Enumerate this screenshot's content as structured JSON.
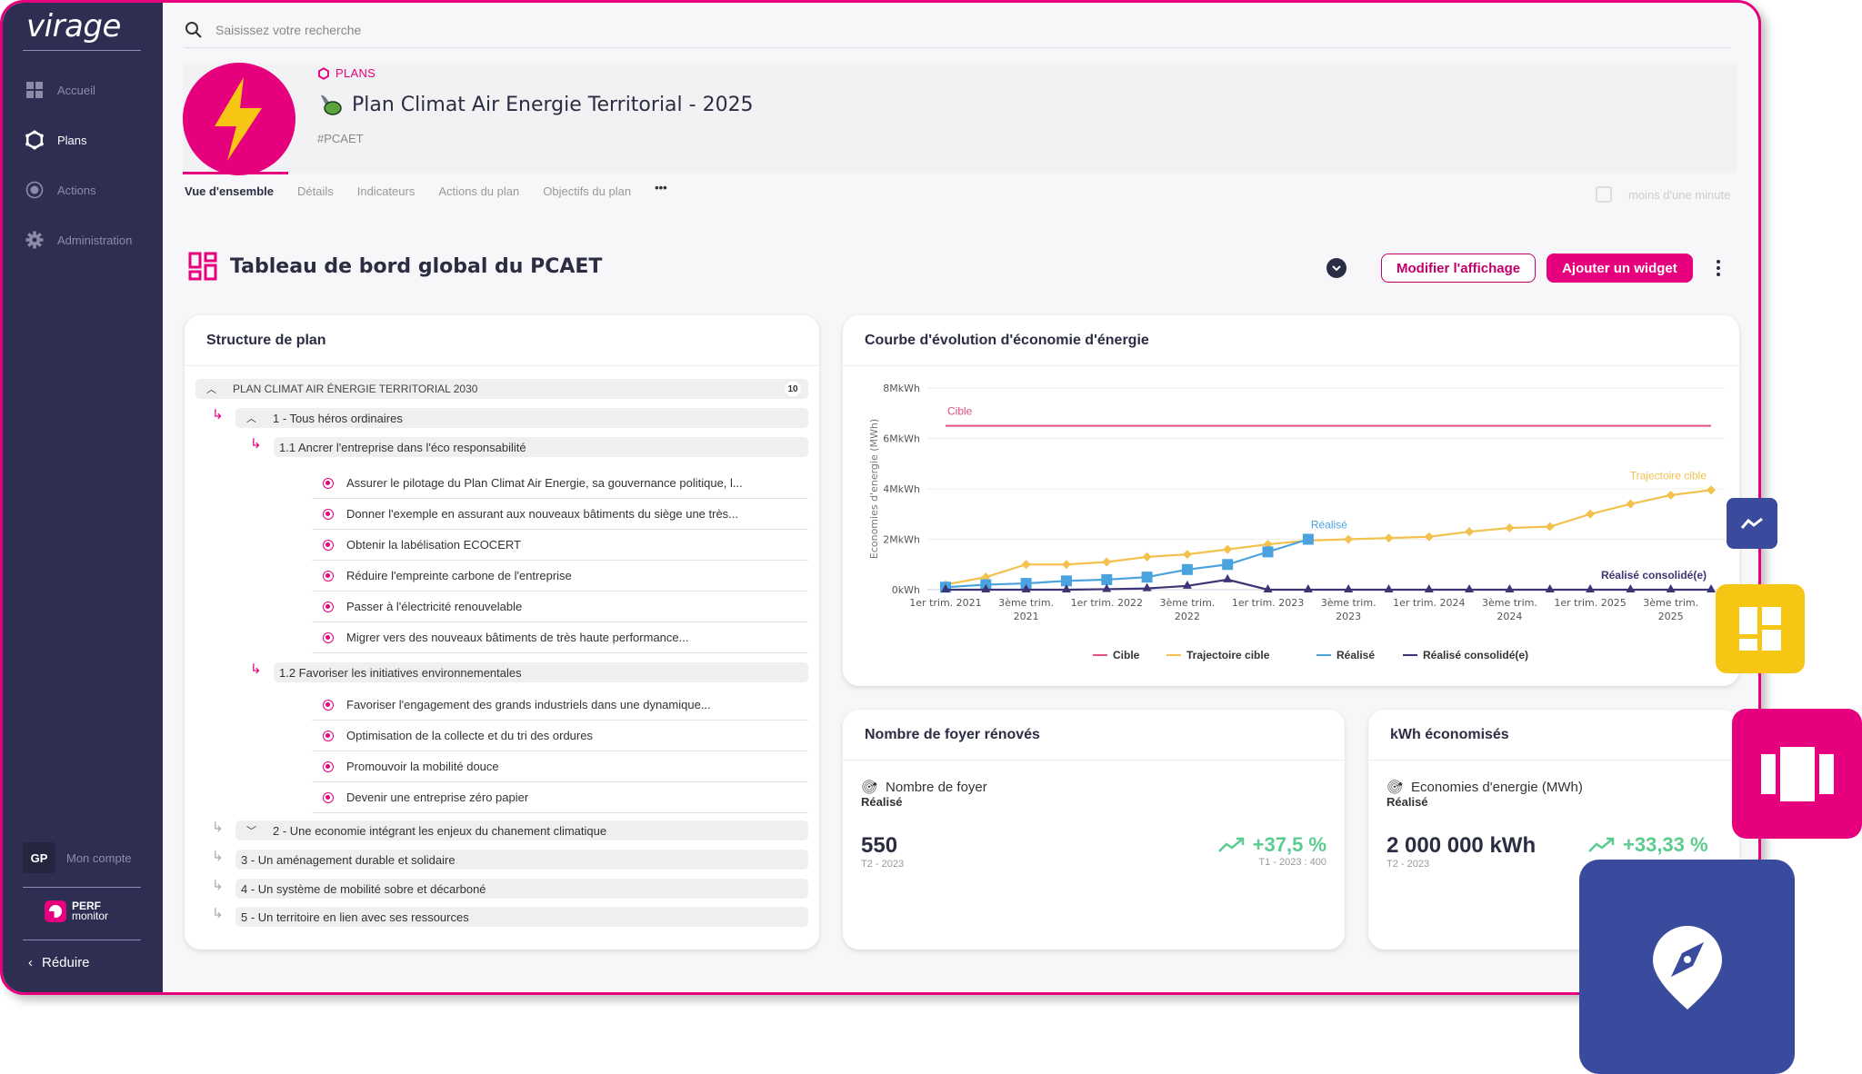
{
  "app": {
    "logo": "virage",
    "search_placeholder": "Saisissez votre recherche"
  },
  "sidebar": {
    "items": [
      {
        "label": "Accueil",
        "icon": "dashboard-icon",
        "active": false
      },
      {
        "label": "Plans",
        "icon": "plans-icon",
        "active": true
      },
      {
        "label": "Actions",
        "icon": "target-icon",
        "active": false
      },
      {
        "label": "Administration",
        "icon": "gear-icon",
        "active": false
      }
    ],
    "account_initials": "GP",
    "account_label": "Mon compte",
    "partner_line1": "PERF",
    "partner_line2": "monitor",
    "reduce_label": "Réduire"
  },
  "plan": {
    "breadcrumb": "PLANS",
    "title": "Plan Climat Air Energie Territorial - 2025",
    "tag": "#PCAET",
    "tabs": [
      {
        "label": "Vue d'ensemble",
        "active": true
      },
      {
        "label": "Détails",
        "active": false
      },
      {
        "label": "Indicateurs",
        "active": false
      },
      {
        "label": "Actions du plan",
        "active": false
      },
      {
        "label": "Objectifs du plan",
        "active": false
      },
      {
        "label": "•••",
        "active": false
      }
    ],
    "saved_label": "moins d'une minute"
  },
  "dashboard": {
    "title": "Tableau de bord global du PCAET",
    "edit_label": "Modifier l'affichage",
    "add_widget_label": "Ajouter un widget"
  },
  "structure": {
    "title": "Structure de plan",
    "root": {
      "label": "PLAN CLIMAT AIR ÉNERGIE TERRITORIAL 2030",
      "count": "10"
    },
    "axes": [
      {
        "label": "1 - Tous héros ordinaires",
        "expanded": true
      },
      {
        "label": "2 - Une economie intégrant les enjeux du chanement climatique",
        "expanded": false
      },
      {
        "label": "3 - Un aménagement durable et solidaire"
      },
      {
        "label": "4 - Un système de mobilité sobre et décarboné"
      },
      {
        "label": "5 - Un territoire en lien avec ses ressources"
      }
    ],
    "sub1": {
      "label": "1.1 Ancrer l'entreprise dans l'éco responsabilité",
      "actions": [
        "Assurer le pilotage du Plan Climat Air Energie, sa gouvernance politique, l...",
        "Donner l'exemple en assurant aux nouveaux bâtiments du siège une très...",
        "Obtenir la labélisation ECOCERT",
        "Réduire l'empreinte carbone de l'entreprise",
        "Passer à l'électricité renouvelable",
        "Migrer vers des nouveaux bâtiments de très haute performance..."
      ]
    },
    "sub2": {
      "label": "1.2 Favoriser les initiatives environnementales",
      "actions": [
        "Favoriser l'engagement des grands industriels dans une dynamique...",
        "Optimisation de la collecte et du tri des ordures",
        "Promouvoir la mobilité douce",
        "Devenir une entreprise zéro papier"
      ]
    }
  },
  "chart_widget": {
    "title": "Courbe d'évolution d'économie d'énergie"
  },
  "chart_data": {
    "type": "line",
    "title": "Courbe d'évolution d'économie d'énergie",
    "xlabel": "",
    "ylabel": "Economies d'energie (MWh)",
    "y_ticks": [
      "0kWh",
      "2MkWh",
      "4MkWh",
      "6MkWh",
      "8MkWh"
    ],
    "ylim": [
      0,
      8
    ],
    "y_unit": "MkWh",
    "grid": true,
    "legend_position": "bottom",
    "x": [
      "T1 2021",
      "T2 2021",
      "T3 2021",
      "T4 2021",
      "T1 2022",
      "T2 2022",
      "T3 2022",
      "T4 2022",
      "T1 2023",
      "T2 2023",
      "T3 2023",
      "T4 2023",
      "T1 2024",
      "T2 2024",
      "T3 2024",
      "T4 2024",
      "T1 2025",
      "T2 2025",
      "T3 2025",
      "T4 2025"
    ],
    "x_tick_labels": [
      {
        "index": 0,
        "label": "1er trim. 2021"
      },
      {
        "index": 2,
        "label": "3ème trim. 2021"
      },
      {
        "index": 4,
        "label": "1er trim. 2022"
      },
      {
        "index": 6,
        "label": "3ème trim. 2022"
      },
      {
        "index": 8,
        "label": "1er trim. 2023"
      },
      {
        "index": 10,
        "label": "3ème trim. 2023"
      },
      {
        "index": 12,
        "label": "1er trim. 2024"
      },
      {
        "index": 14,
        "label": "3ème trim. 2024"
      },
      {
        "index": 16,
        "label": "1er trim. 2025"
      },
      {
        "index": 18,
        "label": "3ème trim. 2025"
      }
    ],
    "series": [
      {
        "name": "Cible",
        "color": "#e0507a",
        "marker": "none",
        "label": "Cible",
        "values": [
          6.5,
          6.5,
          6.5,
          6.5,
          6.5,
          6.5,
          6.5,
          6.5,
          6.5,
          6.5,
          6.5,
          6.5,
          6.5,
          6.5,
          6.5,
          6.5,
          6.5,
          6.5,
          6.5,
          6.5
        ]
      },
      {
        "name": "Trajectoire cible",
        "color": "#f2c14e",
        "marker": "diamond",
        "label": "Trajectoire cible",
        "values": [
          0.2,
          0.5,
          1.0,
          1.0,
          1.1,
          1.3,
          1.4,
          1.6,
          1.8,
          1.95,
          2.0,
          2.05,
          2.1,
          2.3,
          2.45,
          2.5,
          3.0,
          3.4,
          3.75,
          3.95
        ]
      },
      {
        "name": "Réalisé",
        "color": "#4aa3df",
        "marker": "square",
        "label": "Réalisé",
        "values": [
          0.1,
          0.2,
          0.25,
          0.35,
          0.4,
          0.5,
          0.8,
          1.0,
          1.5,
          2.0
        ]
      },
      {
        "name": "Réalisé consolidé(e)",
        "color": "#3b3575",
        "marker": "triangle",
        "label": "Réalisé consolidé(e)",
        "values": [
          0,
          0,
          0,
          0,
          0.02,
          0.05,
          0.15,
          0.4,
          0,
          0,
          0,
          0,
          0,
          0,
          0,
          0,
          0,
          0,
          0,
          0
        ]
      }
    ]
  },
  "kpi_foyers": {
    "title": "Nombre de foyer rénovés",
    "indicator": "Nombre de foyer",
    "status": "Réalisé",
    "value": "550",
    "period": "T2 - 2023",
    "delta": "+37,5 %",
    "previous": "T1 - 2023 : 400"
  },
  "kpi_kwh": {
    "title": "kWh économisés",
    "indicator": "Economies d'energie (MWh)",
    "status": "Réalisé",
    "value": "2 000 000 kWh",
    "period": "T2 - 2023",
    "delta": "+33,33 %"
  },
  "colors": {
    "brand": "#e6007e",
    "sidebar": "#2d2e52",
    "positive": "#5ccb8f",
    "deco_blue": "#3a4a9c",
    "deco_yellow": "#f7c615"
  }
}
